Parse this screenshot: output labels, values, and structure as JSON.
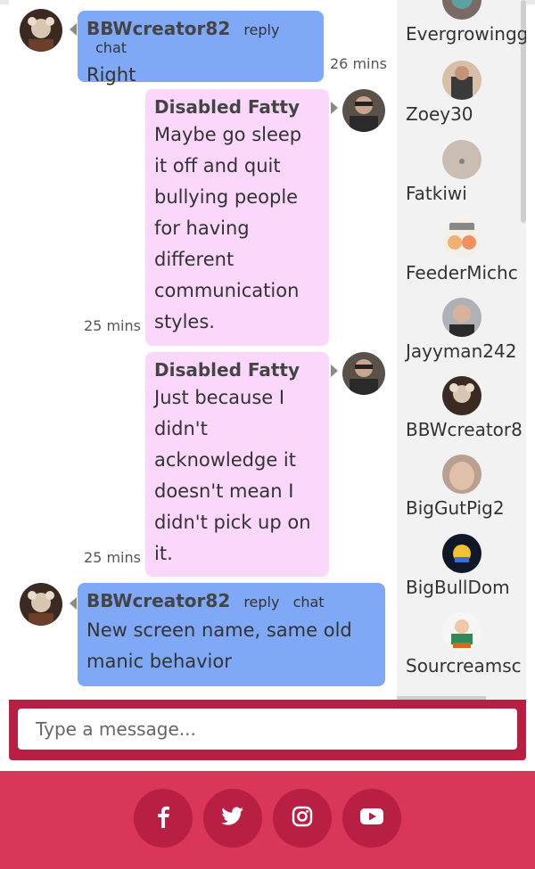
{
  "messages": [
    {
      "user": "BBWcreator82",
      "reply": "reply",
      "chat": "chat",
      "lines": [
        "Right"
      ],
      "time": "26 mins"
    },
    {
      "user": "Disabled Fatty",
      "lines": [
        "Maybe go sleep",
        "it off and quit",
        "bullying people",
        "for having",
        "different",
        "communication",
        "styles."
      ],
      "time": "25 mins"
    },
    {
      "user": "Disabled Fatty",
      "lines": [
        "Just because I",
        "didn't",
        "acknowledge it",
        "doesn't mean I",
        "didn't pick up on",
        "it."
      ],
      "time": "25 mins"
    },
    {
      "user": "BBWcreator82",
      "reply": "reply",
      "chat": "chat",
      "lines": [
        "New screen name, same old",
        "manic behavior"
      ]
    }
  ],
  "users": [
    "Evergrowingg",
    "Zoey30",
    "Fatkiwi",
    "FeederMichc",
    "Jayyman242",
    "BBWcreator8",
    "BigGutPig2",
    "BigBullDom",
    "Sourcreamsc"
  ],
  "input": {
    "placeholder": "Type a message..."
  },
  "social": [
    "facebook-icon",
    "twitter-icon",
    "instagram-icon",
    "youtube-icon"
  ],
  "colors": {
    "blue_bubble": "#7fa8f7",
    "pink_bubble": "#fbd8fb",
    "accent": "#b91f42",
    "footer": "#d9365a"
  }
}
